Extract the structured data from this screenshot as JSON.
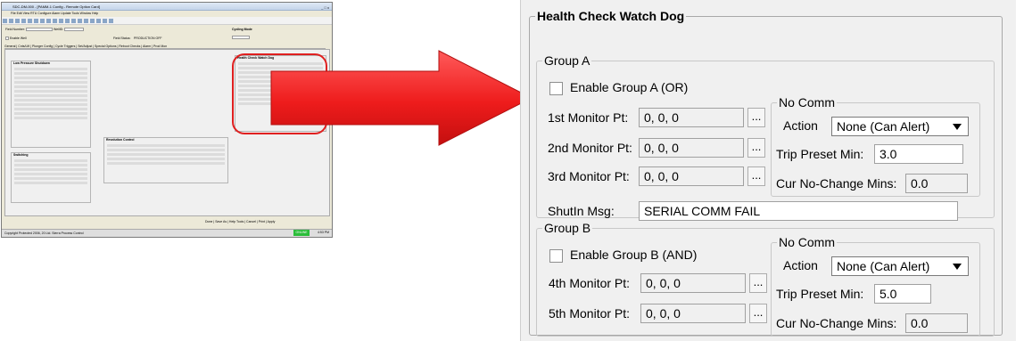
{
  "mini_screenshot": {
    "window_title": "SDC-DM-000 - [PAMM-1 Config - Remote Option Card]",
    "window_controls": "_ □ x",
    "menu": "File  Edit  View  RTU  Configure  Alarm  Update  Tools  Window  Help",
    "field_number_label": "Field Number:",
    "field_number_value": "1  Well 1",
    "well_id_label": "WellID:",
    "well_id_value": "Well 1",
    "cycling_mode_label": "Cycling Mode",
    "cycling_mode_value": "Auto",
    "enable_well_label": "Enable Well",
    "field_status_label": "Field Status:",
    "field_status_value": "PRODUCTION OFF",
    "field_status_extra": "0",
    "tabs": "General | Cnts/Lift | Plunger Config | Cycle Triggers | Set/Adjust | Special Options | Reboot Checks | Alarm | Prod Mon",
    "low_pressure_title": "Low Pressure Shutdown",
    "health_title": "Health Check Watch Dog",
    "switching_title": "Switching",
    "revolution_title": "Revolution Control",
    "buttons": "Done | Save As | Help Tools | Cancel | Print | Apply",
    "status_text": "Copyright Protected 2006, 20 Ltd. Sierra Process Control",
    "status_badge": "ONLINE",
    "status_time": "4:53 PM"
  },
  "health_check": {
    "title": "Health Check Watch Dog",
    "group_a": {
      "title": "Group A",
      "enable_label": "Enable Group A (OR)",
      "monitors": [
        {
          "label": "1st Monitor Pt:",
          "value": "0, 0, 0",
          "browse": "..."
        },
        {
          "label": "2nd Monitor Pt:",
          "value": "0, 0, 0",
          "browse": "..."
        },
        {
          "label": "3rd Monitor Pt:",
          "value": "0, 0, 0",
          "browse": "..."
        }
      ],
      "no_comm": {
        "title": "No Comm",
        "action_label": "Action",
        "action_value": "None (Can Alert)",
        "trip_label": "Trip Preset Min:",
        "trip_value": "3.0",
        "cur_label": "Cur No-Change Mins:",
        "cur_value": "0.0"
      },
      "shutin_label": "ShutIn Msg:",
      "shutin_value": "SERIAL COMM FAIL"
    },
    "group_b": {
      "title": "Group B",
      "enable_label": "Enable Group B (AND)",
      "monitors": [
        {
          "label": "4th Monitor Pt:",
          "value": "0, 0, 0",
          "browse": "..."
        },
        {
          "label": "5th Monitor Pt:",
          "value": "0, 0, 0",
          "browse": "..."
        }
      ],
      "no_comm": {
        "title": "No Comm",
        "action_label": "Action",
        "action_value": "None (Can Alert)",
        "trip_label": "Trip Preset Min:",
        "trip_value": "5.0",
        "cur_label": "Cur No-Change Mins:",
        "cur_value": "0.0"
      }
    }
  },
  "colors": {
    "highlight": "#e02020",
    "arrow": "#ee1c1c",
    "status_badge": "#2bbd3a"
  }
}
